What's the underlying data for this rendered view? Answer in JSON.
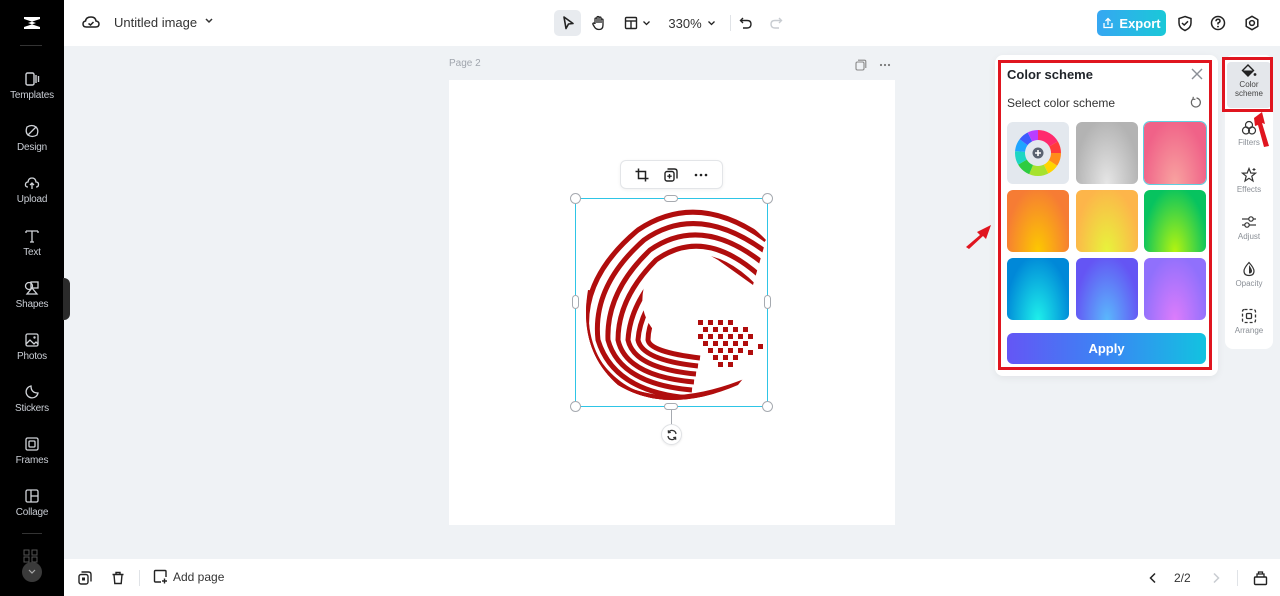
{
  "app": {
    "logo": "capcut-logo-icon"
  },
  "sidebar": {
    "items": [
      {
        "label": "Templates",
        "icon": "templates-icon"
      },
      {
        "label": "Design",
        "icon": "design-icon"
      },
      {
        "label": "Upload",
        "icon": "upload-icon"
      },
      {
        "label": "Text",
        "icon": "text-icon"
      },
      {
        "label": "Shapes",
        "icon": "shapes-icon"
      },
      {
        "label": "Photos",
        "icon": "photos-icon"
      },
      {
        "label": "Stickers",
        "icon": "stickers-icon"
      },
      {
        "label": "Frames",
        "icon": "frames-icon"
      },
      {
        "label": "Collage",
        "icon": "collage-icon"
      }
    ]
  },
  "header": {
    "title": "Untitled image",
    "zoom": "330%",
    "export_label": "Export"
  },
  "canvas": {
    "page_label": "Page 2"
  },
  "color_panel": {
    "title": "Color scheme",
    "subtitle": "Select color scheme",
    "apply_label": "Apply",
    "swatches": [
      {
        "name": "custom-color-picker",
        "selected": false
      },
      {
        "name": "gray",
        "colors": [
          "#b3b3b3",
          "#e6e6e6"
        ],
        "selected": false
      },
      {
        "name": "pink-coral",
        "colors": [
          "#f06288",
          "#f8a3a0"
        ],
        "selected": true
      },
      {
        "name": "orange",
        "colors": [
          "#f67c34",
          "#fcc900"
        ],
        "selected": false
      },
      {
        "name": "yellow",
        "colors": [
          "#fdb54a",
          "#e7f43b"
        ],
        "selected": false
      },
      {
        "name": "green",
        "colors": [
          "#07c35f",
          "#b5f40f"
        ],
        "selected": false
      },
      {
        "name": "cyan-blue",
        "colors": [
          "#0088d8",
          "#1ef0ea"
        ],
        "selected": false
      },
      {
        "name": "indigo-blue",
        "colors": [
          "#6455f4",
          "#5ab8fc"
        ],
        "selected": false
      },
      {
        "name": "violet",
        "colors": [
          "#9070fc",
          "#dd7cfb"
        ],
        "selected": false
      }
    ]
  },
  "props_rail": {
    "items": [
      {
        "label_line1": "Color",
        "label_line2": "scheme",
        "active": true
      },
      {
        "label_line1": "Filters",
        "label_line2": ""
      },
      {
        "label_line1": "Effects",
        "label_line2": ""
      },
      {
        "label_line1": "Adjust",
        "label_line2": ""
      },
      {
        "label_line1": "Opacity",
        "label_line2": ""
      },
      {
        "label_line1": "Arrange",
        "label_line2": ""
      }
    ]
  },
  "footer": {
    "add_page_label": "Add page",
    "pager": "2/2"
  },
  "annotation_color": "#e0151f",
  "accent_color": "#2ec5e6"
}
